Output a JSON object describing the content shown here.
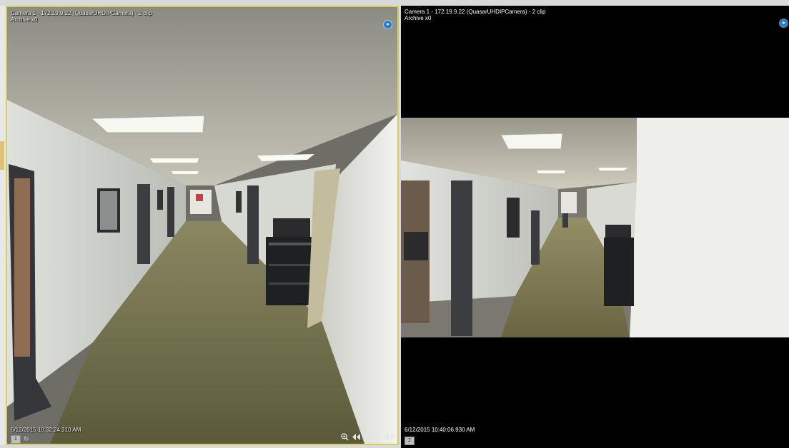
{
  "tiles": [
    {
      "title": "Camera 1 - 172.19.9.22 (QuasarUHDIPCamera) - 2 clip",
      "mode": "Archive x0",
      "timestamp": "6/12/2015 10:32:24.310 AM",
      "number": "1",
      "selected": true,
      "border_color": "#d4cd62"
    },
    {
      "title": "Camera 1 - 172.19.9.22 (QuasarUHDIPCamera) - 2 clip",
      "mode": "Archive x0",
      "timestamp": "6/12/2015 10:40:06.930 AM",
      "number": "2",
      "selected": false
    }
  ],
  "icons": {
    "play_badge": "play-circle-icon",
    "sync": "sync-icon",
    "zoom": "zoom-in-icon",
    "rewind": "rewind-icon",
    "play": "play-icon",
    "pause": "pause-icon",
    "forward": "fast-forward-icon"
  },
  "colors": {
    "accent": "#1f7fd6",
    "selection_border": "#d4cd62",
    "overlay_text": "#ffffff"
  }
}
